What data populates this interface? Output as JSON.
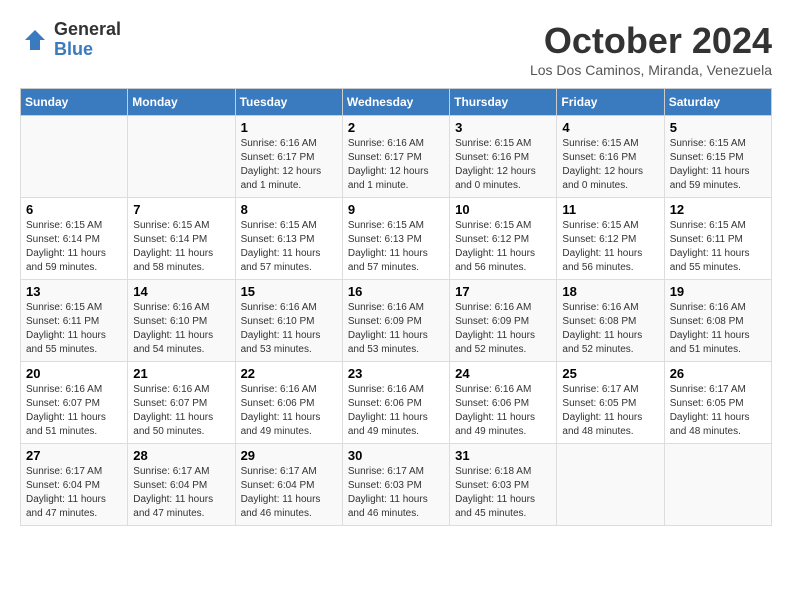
{
  "logo": {
    "general": "General",
    "blue": "Blue"
  },
  "title": "October 2024",
  "location": "Los Dos Caminos, Miranda, Venezuela",
  "days_of_week": [
    "Sunday",
    "Monday",
    "Tuesday",
    "Wednesday",
    "Thursday",
    "Friday",
    "Saturday"
  ],
  "weeks": [
    [
      {
        "day": "",
        "info": ""
      },
      {
        "day": "",
        "info": ""
      },
      {
        "day": "1",
        "info": "Sunrise: 6:16 AM\nSunset: 6:17 PM\nDaylight: 12 hours and 1 minute."
      },
      {
        "day": "2",
        "info": "Sunrise: 6:16 AM\nSunset: 6:17 PM\nDaylight: 12 hours and 1 minute."
      },
      {
        "day": "3",
        "info": "Sunrise: 6:15 AM\nSunset: 6:16 PM\nDaylight: 12 hours and 0 minutes."
      },
      {
        "day": "4",
        "info": "Sunrise: 6:15 AM\nSunset: 6:16 PM\nDaylight: 12 hours and 0 minutes."
      },
      {
        "day": "5",
        "info": "Sunrise: 6:15 AM\nSunset: 6:15 PM\nDaylight: 11 hours and 59 minutes."
      }
    ],
    [
      {
        "day": "6",
        "info": "Sunrise: 6:15 AM\nSunset: 6:14 PM\nDaylight: 11 hours and 59 minutes."
      },
      {
        "day": "7",
        "info": "Sunrise: 6:15 AM\nSunset: 6:14 PM\nDaylight: 11 hours and 58 minutes."
      },
      {
        "day": "8",
        "info": "Sunrise: 6:15 AM\nSunset: 6:13 PM\nDaylight: 11 hours and 57 minutes."
      },
      {
        "day": "9",
        "info": "Sunrise: 6:15 AM\nSunset: 6:13 PM\nDaylight: 11 hours and 57 minutes."
      },
      {
        "day": "10",
        "info": "Sunrise: 6:15 AM\nSunset: 6:12 PM\nDaylight: 11 hours and 56 minutes."
      },
      {
        "day": "11",
        "info": "Sunrise: 6:15 AM\nSunset: 6:12 PM\nDaylight: 11 hours and 56 minutes."
      },
      {
        "day": "12",
        "info": "Sunrise: 6:15 AM\nSunset: 6:11 PM\nDaylight: 11 hours and 55 minutes."
      }
    ],
    [
      {
        "day": "13",
        "info": "Sunrise: 6:15 AM\nSunset: 6:11 PM\nDaylight: 11 hours and 55 minutes."
      },
      {
        "day": "14",
        "info": "Sunrise: 6:16 AM\nSunset: 6:10 PM\nDaylight: 11 hours and 54 minutes."
      },
      {
        "day": "15",
        "info": "Sunrise: 6:16 AM\nSunset: 6:10 PM\nDaylight: 11 hours and 53 minutes."
      },
      {
        "day": "16",
        "info": "Sunrise: 6:16 AM\nSunset: 6:09 PM\nDaylight: 11 hours and 53 minutes."
      },
      {
        "day": "17",
        "info": "Sunrise: 6:16 AM\nSunset: 6:09 PM\nDaylight: 11 hours and 52 minutes."
      },
      {
        "day": "18",
        "info": "Sunrise: 6:16 AM\nSunset: 6:08 PM\nDaylight: 11 hours and 52 minutes."
      },
      {
        "day": "19",
        "info": "Sunrise: 6:16 AM\nSunset: 6:08 PM\nDaylight: 11 hours and 51 minutes."
      }
    ],
    [
      {
        "day": "20",
        "info": "Sunrise: 6:16 AM\nSunset: 6:07 PM\nDaylight: 11 hours and 51 minutes."
      },
      {
        "day": "21",
        "info": "Sunrise: 6:16 AM\nSunset: 6:07 PM\nDaylight: 11 hours and 50 minutes."
      },
      {
        "day": "22",
        "info": "Sunrise: 6:16 AM\nSunset: 6:06 PM\nDaylight: 11 hours and 49 minutes."
      },
      {
        "day": "23",
        "info": "Sunrise: 6:16 AM\nSunset: 6:06 PM\nDaylight: 11 hours and 49 minutes."
      },
      {
        "day": "24",
        "info": "Sunrise: 6:16 AM\nSunset: 6:06 PM\nDaylight: 11 hours and 49 minutes."
      },
      {
        "day": "25",
        "info": "Sunrise: 6:17 AM\nSunset: 6:05 PM\nDaylight: 11 hours and 48 minutes."
      },
      {
        "day": "26",
        "info": "Sunrise: 6:17 AM\nSunset: 6:05 PM\nDaylight: 11 hours and 48 minutes."
      }
    ],
    [
      {
        "day": "27",
        "info": "Sunrise: 6:17 AM\nSunset: 6:04 PM\nDaylight: 11 hours and 47 minutes."
      },
      {
        "day": "28",
        "info": "Sunrise: 6:17 AM\nSunset: 6:04 PM\nDaylight: 11 hours and 47 minutes."
      },
      {
        "day": "29",
        "info": "Sunrise: 6:17 AM\nSunset: 6:04 PM\nDaylight: 11 hours and 46 minutes."
      },
      {
        "day": "30",
        "info": "Sunrise: 6:17 AM\nSunset: 6:03 PM\nDaylight: 11 hours and 46 minutes."
      },
      {
        "day": "31",
        "info": "Sunrise: 6:18 AM\nSunset: 6:03 PM\nDaylight: 11 hours and 45 minutes."
      },
      {
        "day": "",
        "info": ""
      },
      {
        "day": "",
        "info": ""
      }
    ]
  ]
}
